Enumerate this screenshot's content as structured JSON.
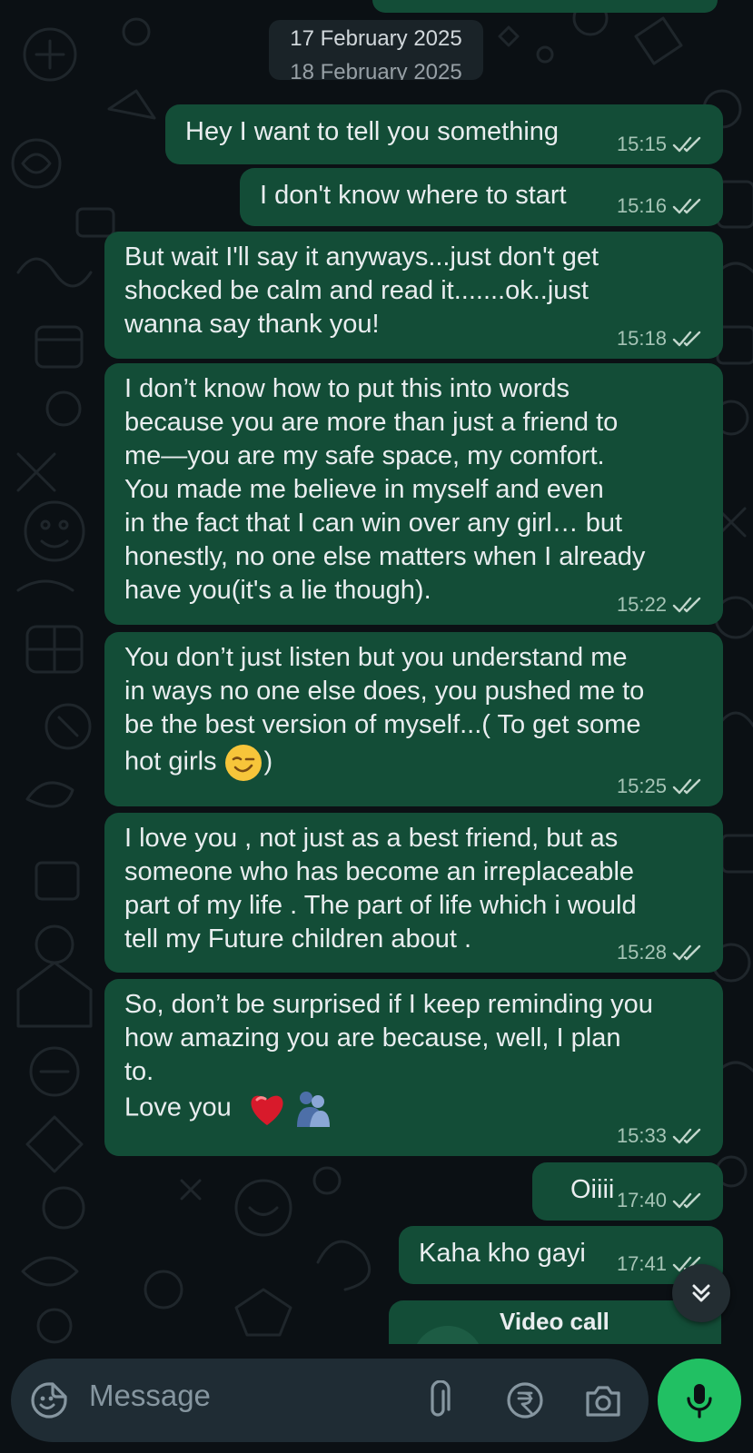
{
  "date_chip": {
    "primary": "17 February 2025",
    "ghost": "18 February 2025"
  },
  "messages": [
    {
      "text": "Hey I want to tell you something",
      "time": "15:15",
      "status_icon": "double-check-read"
    },
    {
      "text": "I don't know where to start",
      "time": "15:16",
      "status_icon": "double-check-read"
    },
    {
      "text": "But wait I'll say it anyways...just don't get\nshocked be calm and read it.......ok..just\nwanna say thank you!",
      "time": "15:18",
      "status_icon": "double-check-read"
    },
    {
      "text": "I don’t know how to put this into words\nbecause you are more than just a friend to\nme—you are my safe space, my comfort.\nYou made me believe in myself and even\nin the fact that I can win over any girl… but\nhonestly, no one else matters when I already\nhave you(it's a lie though).",
      "time": "15:22",
      "status_icon": "double-check-read"
    },
    {
      "text": "You don’t just listen but you understand me\nin ways no one else does, you pushed me to\nbe the best version of myself...( To get some",
      "text_end": "hot girls",
      "text_close": ")",
      "emoji": "winking-face",
      "time": "15:25",
      "status_icon": "double-check-read"
    },
    {
      "text": "I love you , not just as a best friend, but as\nsomeone who has become an irreplaceable\npart of my life . The part of life which i would\ntell my Future children about .",
      "time": "15:28",
      "status_icon": "double-check-read"
    },
    {
      "text": "So, don’t be surprised if I keep reminding you\nhow amazing you are because, well, I plan\nto.",
      "text_end": "Love you",
      "emoji": [
        "red-heart",
        "people-hugging"
      ],
      "time": "15:33",
      "status_icon": "double-check-read"
    },
    {
      "text": "Oiiii",
      "time": "17:40",
      "status_icon": "double-check-read"
    },
    {
      "text": "Kaha kho gayi",
      "time": "17:41",
      "status_icon": "double-check-read"
    }
  ],
  "call_card": {
    "label": "Video call"
  },
  "composer": {
    "placeholder": "Message"
  },
  "colors": {
    "background": "#0b1014",
    "bubble_out": "#134d37",
    "accent_green": "#21c063",
    "composer_bg": "#1f2c34"
  },
  "icons": [
    "sticker-icon",
    "paperclip-icon",
    "rupee-icon",
    "camera-icon",
    "mic-icon",
    "double-chevron-down-icon"
  ]
}
